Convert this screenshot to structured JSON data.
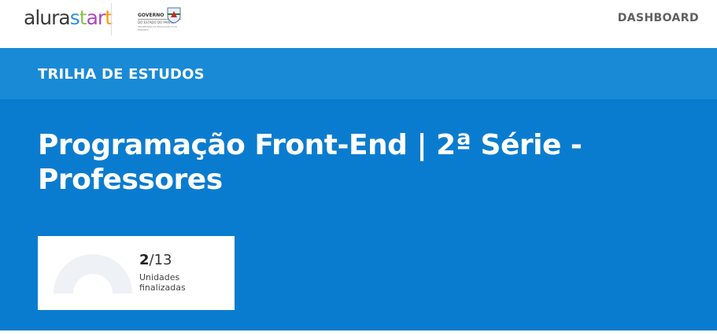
{
  "header": {
    "brand": {
      "alura": "alura",
      "s": "s",
      "t": "t",
      "ar": "ar",
      "tt": "t"
    },
    "gov_logo": {
      "title": "GOVERNO",
      "subtitle": "DO ESTADO DO PARANÁ",
      "secretariat": "SECRETARIA DA EDUCAÇÃO E DO ESPORTE"
    },
    "nav": {
      "dashboard": "DASHBOARD"
    }
  },
  "trail": {
    "section_label": "TRILHA DE ESTUDOS",
    "title": "Programação Front-End | 2ª Série - Professores"
  },
  "progress": {
    "completed": "2",
    "total": "13",
    "separator": "/",
    "label": "Unidades finalizadas",
    "fraction": 0.1538
  },
  "colors": {
    "header_bg": "#ffffff",
    "band_light": "#198ad6",
    "band_main": "#0a7ccf",
    "gauge_track": "#eef1f5"
  },
  "icons": {
    "brand_logo": "alurastart-logo",
    "gov_shield": "parana-shield-icon",
    "progress_gauge": "semicircle-gauge"
  }
}
